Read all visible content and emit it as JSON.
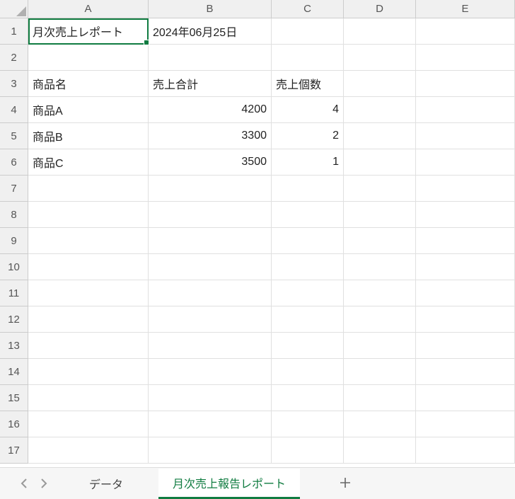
{
  "columns": [
    "A",
    "B",
    "C",
    "D",
    "E"
  ],
  "rowCount": 17,
  "activeCell": "A1",
  "cells": {
    "A1": "月次売上レポート",
    "B1": "2024年06月25日",
    "A3": "商品名",
    "B3": "売上合計",
    "C3": "売上個数",
    "A4": "商品A",
    "B4": "4200",
    "C4": "4",
    "A5": "商品B",
    "B5": "3300",
    "C5": "2",
    "A6": "商品C",
    "B6": "3500",
    "C6": "1"
  },
  "numericCells": [
    "B4",
    "B5",
    "B6",
    "C4",
    "C5",
    "C6"
  ],
  "sheetTabs": {
    "tabs": [
      {
        "name": "データ",
        "active": false
      },
      {
        "name": "月次売上報告レポート",
        "active": true
      }
    ]
  }
}
